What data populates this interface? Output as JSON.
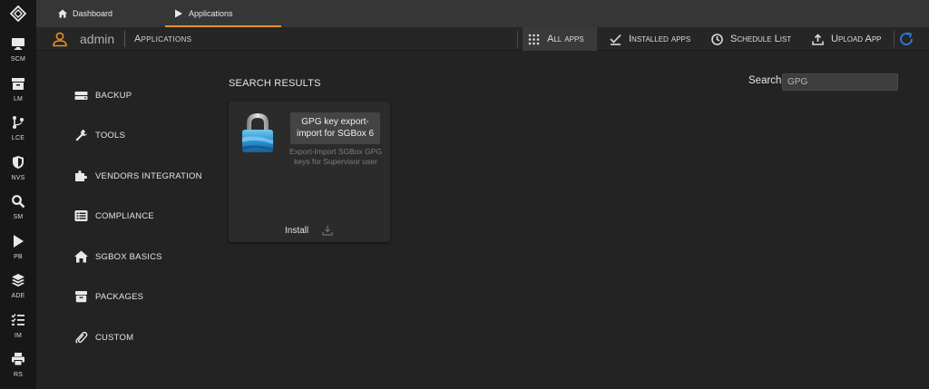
{
  "rail": {
    "items": [
      {
        "label": "SCM",
        "icon": "monitor-icon"
      },
      {
        "label": "LM",
        "icon": "archive-icon"
      },
      {
        "label": "LCE",
        "icon": "branch-icon"
      },
      {
        "label": "NVS",
        "icon": "shield-icon"
      },
      {
        "label": "SM",
        "icon": "search-icon"
      },
      {
        "label": "PB",
        "icon": "play-icon"
      },
      {
        "label": "ADE",
        "icon": "layers-icon"
      },
      {
        "label": "IM",
        "icon": "list-check-icon"
      },
      {
        "label": "RS",
        "icon": "printer-icon"
      }
    ]
  },
  "topbar": {
    "tabs": [
      {
        "label": "Dashboard",
        "icon": "home-icon"
      },
      {
        "label": "Applications",
        "icon": "play-icon"
      }
    ]
  },
  "header": {
    "user": "admin",
    "title": "Applications",
    "nav": {
      "all_apps": "All apps",
      "installed_apps": "Installed apps",
      "schedule_list": "Schedule List",
      "upload_app": "Upload App"
    }
  },
  "categories": [
    {
      "label": "BACKUP",
      "icon": "drive-icon"
    },
    {
      "label": "TOOLS",
      "icon": "wrench-icon"
    },
    {
      "label": "VENDORS INTEGRATION",
      "icon": "puzzle-icon"
    },
    {
      "label": "COMPLIANCE",
      "icon": "list-icon"
    },
    {
      "label": "SGBOX BASICS",
      "icon": "home-icon"
    },
    {
      "label": "PACKAGES",
      "icon": "box-icon"
    },
    {
      "label": "CUSTOM",
      "icon": "paperclip-icon"
    }
  ],
  "results": {
    "title": "SEARCH RESULTS",
    "search_label": "Search",
    "search_value": "GPG",
    "apps": [
      {
        "name": "GPG key export-import for SGBox 6",
        "description": "Export-Import SGBox GPG keys for Supervisor user",
        "install_label": "Install"
      }
    ]
  },
  "colors": {
    "accent": "#e8902a",
    "refresh": "#2e7dd6",
    "background": "#232323"
  }
}
